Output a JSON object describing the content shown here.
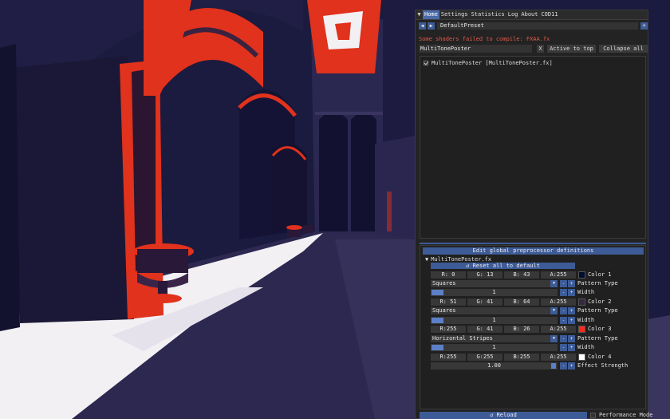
{
  "colors": {
    "accent": "#3d5b96",
    "window_bg": "#232323",
    "warning": "#e05a4a",
    "scene_shadow": "#1b1a3f",
    "scene_red": "#e0321c",
    "scene_light": "#f3f0f4"
  },
  "menu": {
    "icon": "menu-glyph-icon",
    "items": [
      "Home",
      "Settings",
      "Statistics",
      "Log",
      "About",
      "COD11"
    ]
  },
  "preset": {
    "prev_icon": "chevron-left-icon",
    "next_icon": "chevron-right-icon",
    "name": "DefaultPreset",
    "add_label": "+"
  },
  "warning": "Some shaders failed to compile: FXAA.fx",
  "search": {
    "value": "MultiTonePoster",
    "clear_label": "X",
    "active_to_top": "Active to top",
    "collapse_all": "Collapse all"
  },
  "effects": [
    {
      "label": "MultiTonePoster [MultiTonePoster.fx]",
      "checked": true
    }
  ],
  "preprocessor_button": "Edit global preprocessor definitions",
  "section": {
    "title": "MultiTonePoster.fx",
    "reset_label": "Reset all to default"
  },
  "params": {
    "color1": {
      "r": "R:  0",
      "g": "G: 13",
      "b": "B: 43",
      "a": "A:255",
      "hex": "#000d2b",
      "label": "Color 1"
    },
    "pattern1": {
      "value": "Squares",
      "label": "Pattern Type"
    },
    "width1": {
      "value": "1",
      "fraction": 0.06,
      "label": "Width"
    },
    "color2": {
      "r": "R: 51",
      "g": "G: 41",
      "b": "B: 64",
      "a": "A:255",
      "hex": "#332940",
      "label": "Color 2"
    },
    "pattern2": {
      "value": "Squares",
      "label": "Pattern Type"
    },
    "width2": {
      "value": "1",
      "fraction": 0.06,
      "label": "Width"
    },
    "color3": {
      "r": "R:255",
      "g": "G: 41",
      "b": "B: 26",
      "a": "A:255",
      "hex": "#ff291a",
      "label": "Color 3"
    },
    "pattern3": {
      "value": "Horizontal Stripes",
      "label": "Pattern Type"
    },
    "width3": {
      "value": "1",
      "fraction": 0.06,
      "label": "Width"
    },
    "color4": {
      "r": "R:255",
      "g": "G:255",
      "b": "B:255",
      "a": "A:255",
      "hex": "#ffffff",
      "label": "Color 4"
    },
    "strength": {
      "value": "1.00",
      "fraction": 1.0,
      "label": "Effect Strength"
    },
    "minus": "-",
    "plus": "+"
  },
  "footer": {
    "reload": "Reload",
    "performance_mode": "Performance Mode"
  }
}
